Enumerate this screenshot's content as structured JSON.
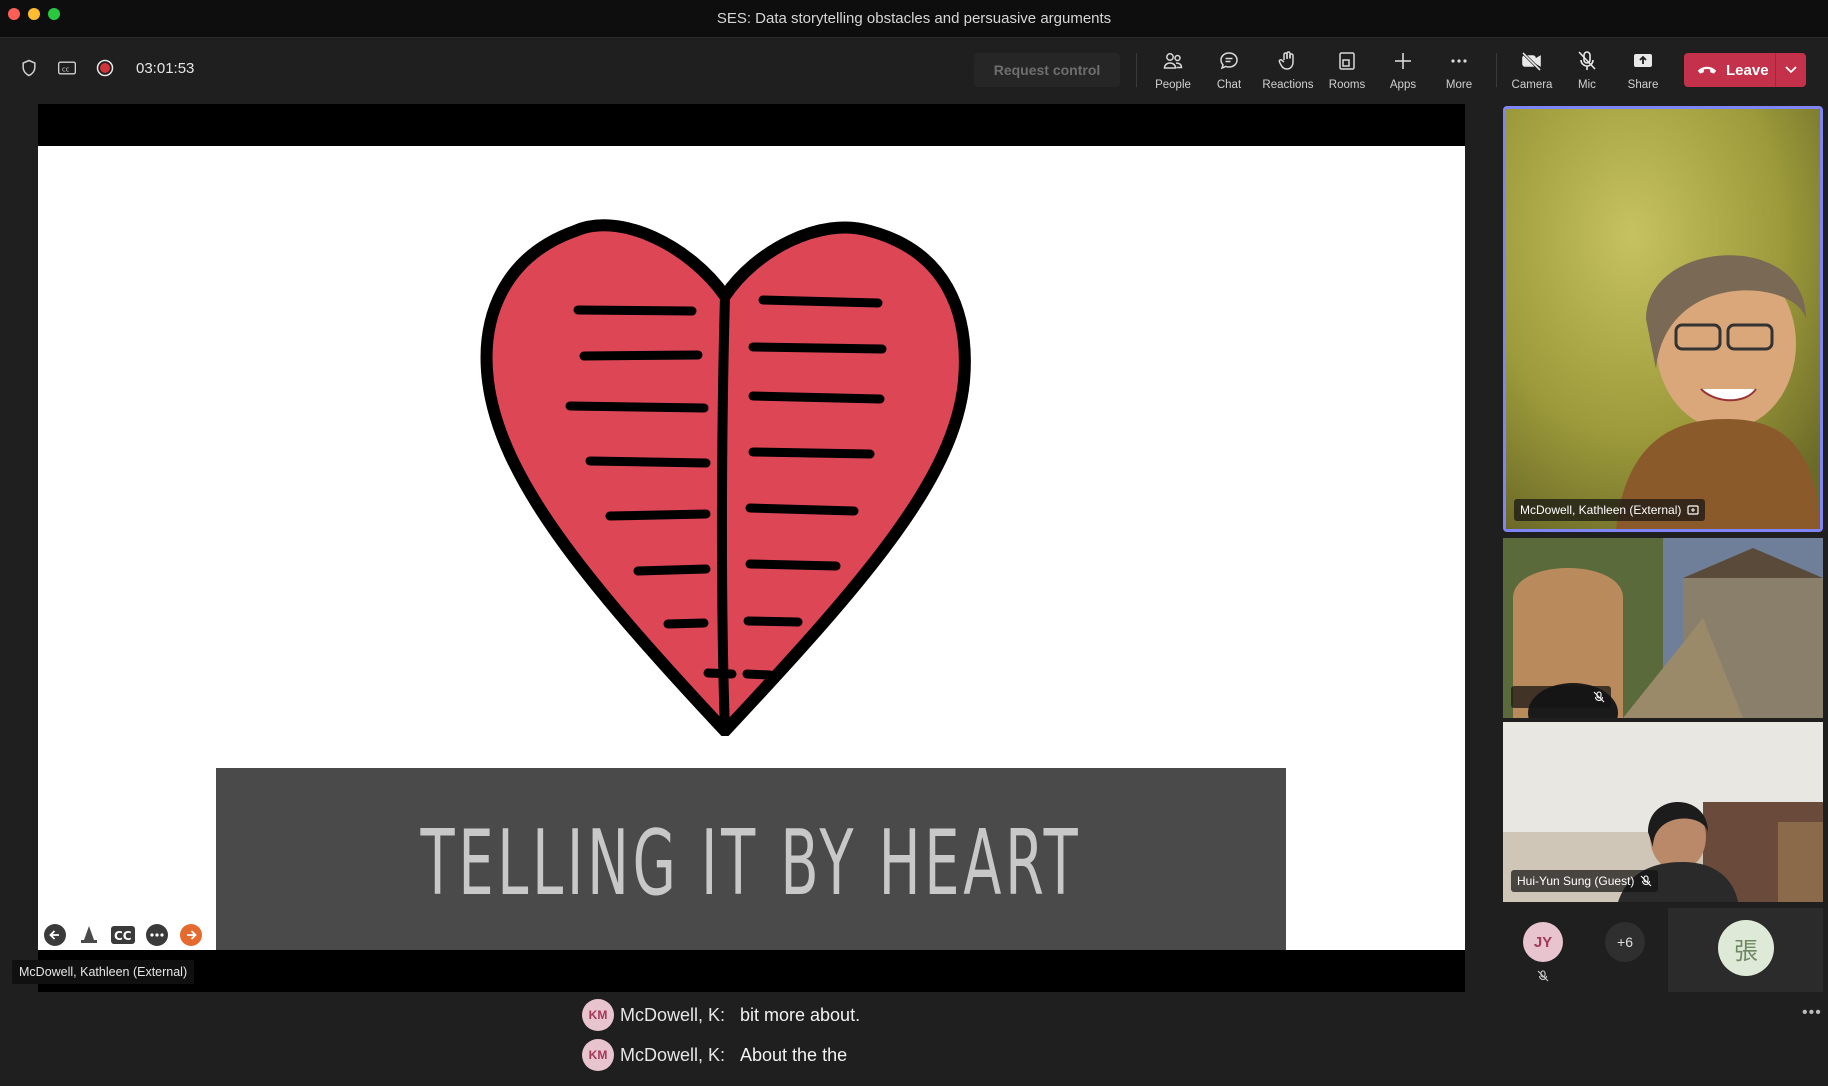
{
  "window": {
    "title": "SES: Data storytelling obstacles and persuasive arguments"
  },
  "toolbar": {
    "timer": "03:01:53",
    "request_control": "Request control",
    "buttons": [
      {
        "label": "People",
        "icon": "people-icon"
      },
      {
        "label": "Chat",
        "icon": "chat-icon"
      },
      {
        "label": "Reactions",
        "icon": "reactions-icon"
      },
      {
        "label": "Rooms",
        "icon": "rooms-icon"
      },
      {
        "label": "Apps",
        "icon": "plus-icon"
      },
      {
        "label": "More",
        "icon": "more-icon"
      },
      {
        "label": "Camera",
        "icon": "camera-off-icon"
      },
      {
        "label": "Mic",
        "icon": "mic-off-icon"
      },
      {
        "label": "Share",
        "icon": "share-icon"
      }
    ],
    "leave": "Leave"
  },
  "slide": {
    "banner_text": "TELLING IT BY HEART"
  },
  "stage": {
    "presenter": "McDowell, Kathleen (External)"
  },
  "participants": {
    "main_name": "McDowell, Kathleen (External)",
    "third_name": "Hui-Yun Sung (Guest)",
    "jy_initials": "JY",
    "overflow": "+6",
    "zhang_initial": "張"
  },
  "captions": [
    {
      "initials": "KM",
      "speaker": "McDowell, K:",
      "text": "bit more about."
    },
    {
      "initials": "KM",
      "speaker": "McDowell, K:",
      "text": "About the the"
    }
  ],
  "colors": {
    "accent": "#7f85f5",
    "leave": "#c4314b",
    "heart": "#dd4755"
  }
}
